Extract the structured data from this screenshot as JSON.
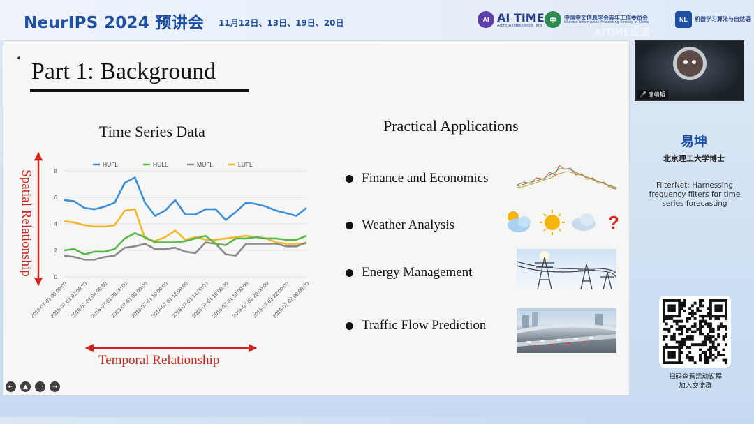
{
  "banner": {
    "event_title": "NeurIPS 2024 预讲会",
    "event_dates": "11月12日、13日、19日、20日",
    "logos": [
      {
        "name": "AI TIME",
        "subtitle": "Artificial Intelligence Time"
      },
      {
        "name": "中国中文信息学会青年工作委员会",
        "subtitle": "Chinese Information Processing Society of China"
      },
      {
        "name": "机器学习算法与自然语言处理",
        "subtitle": ""
      }
    ],
    "watermark": "AITIME论道"
  },
  "slide": {
    "title": "Part 1: Background",
    "chart_title": "Time Series Data",
    "y_relation": "Spatial Relationship",
    "x_relation": "Temporal Relationship",
    "apps_title": "Practical Applications",
    "applications": [
      {
        "label": "Finance and Economics",
        "image": "stock-chart"
      },
      {
        "label": "Weather Analysis",
        "image": "weather-icons",
        "weather_icons": [
          "cloud-sun-icon",
          "sun-icon",
          "cloud-icon",
          "question-icon"
        ],
        "question_mark": "?"
      },
      {
        "label": "Energy Management",
        "image": "power-towers"
      },
      {
        "label": "Traffic Flow Prediction",
        "image": "highway-traffic"
      }
    ],
    "controls": [
      "prev-icon",
      "pen-icon",
      "more-icon",
      "next-icon"
    ]
  },
  "chart_data": {
    "type": "line",
    "title": "",
    "x": [
      "2016-07-01 00:00:00",
      "2016-07-01 01:00:00",
      "2016-07-01 02:00:00",
      "2016-07-01 03:00:00",
      "2016-07-01 04:00:00",
      "2016-07-01 05:00:00",
      "2016-07-01 06:00:00",
      "2016-07-01 07:00:00",
      "2016-07-01 08:00:00",
      "2016-07-01 09:00:00",
      "2016-07-01 10:00:00",
      "2016-07-01 11:00:00",
      "2016-07-01 12:00:00",
      "2016-07-01 13:00:00",
      "2016-07-01 14:00:00",
      "2016-07-01 15:00:00",
      "2016-07-01 16:00:00",
      "2016-07-01 17:00:00",
      "2016-07-01 18:00:00",
      "2016-07-01 19:00:00",
      "2016-07-01 20:00:00",
      "2016-07-01 21:00:00",
      "2016-07-01 22:00:00",
      "2016-07-01 23:00:00",
      "2016-07-02 00:00:00"
    ],
    "x_tick_labels": [
      "2016-07-01 00:00:00",
      "2016-07-01 02:00:00",
      "2016-07-01 04:00:00",
      "2016-07-01 06:00:00",
      "2016-07-01 08:00:00",
      "2016-07-01 10:00:00",
      "2016-07-01 12:00:00",
      "2016-07-01 14:00:00",
      "2016-07-01 16:00:00",
      "2016-07-01 18:00:00",
      "2016-07-01 20:00:00",
      "2016-07-01 22:00:00",
      "2016-07-02 00:00:00"
    ],
    "y_ticks": [
      0,
      2,
      4,
      6,
      8
    ],
    "ylim": [
      0,
      8
    ],
    "grid": "horizontal",
    "legend": "top",
    "series": [
      {
        "name": "HUFL",
        "color": "#3a8fd8",
        "values": [
          5.8,
          5.7,
          5.2,
          5.1,
          5.3,
          5.6,
          7.1,
          7.5,
          5.6,
          4.6,
          5.0,
          5.8,
          4.7,
          4.7,
          5.1,
          5.1,
          4.3,
          4.9,
          5.6,
          5.5,
          5.3,
          5.0,
          4.8,
          4.6,
          5.2
        ]
      },
      {
        "name": "HULL",
        "color": "#5ab84b",
        "values": [
          2.0,
          2.1,
          1.7,
          1.9,
          1.9,
          2.1,
          2.9,
          3.3,
          3.0,
          2.6,
          2.6,
          2.6,
          2.7,
          2.9,
          3.1,
          2.5,
          2.4,
          2.9,
          2.9,
          3.0,
          2.9,
          2.9,
          2.8,
          2.8,
          3.1
        ]
      },
      {
        "name": "MUFL",
        "color": "#8a8a8a",
        "values": [
          1.6,
          1.5,
          1.3,
          1.3,
          1.5,
          1.6,
          2.2,
          2.3,
          2.5,
          2.1,
          2.1,
          2.2,
          1.9,
          1.8,
          2.6,
          2.5,
          1.7,
          1.6,
          2.5,
          2.5,
          2.5,
          2.5,
          2.3,
          2.3,
          2.6
        ]
      },
      {
        "name": "LUFL",
        "color": "#f2b82c",
        "values": [
          4.2,
          4.1,
          3.9,
          3.8,
          3.8,
          3.9,
          5.0,
          5.1,
          2.9,
          2.7,
          3.0,
          3.5,
          2.8,
          3.0,
          2.8,
          2.8,
          2.9,
          3.0,
          3.1,
          3.0,
          2.9,
          2.6,
          2.5,
          2.5,
          2.5
        ]
      }
    ]
  },
  "sidebar": {
    "speaker_video_label": "唐靖韬",
    "presenter_name": "易坤",
    "presenter_affiliation": "北京理工大学博士",
    "paper_title": "FilterNet: Harnessing frequency filters for time series forecasting",
    "qr_caption_line1": "扫码查看活动议程",
    "qr_caption_line2": "加入交流群"
  }
}
